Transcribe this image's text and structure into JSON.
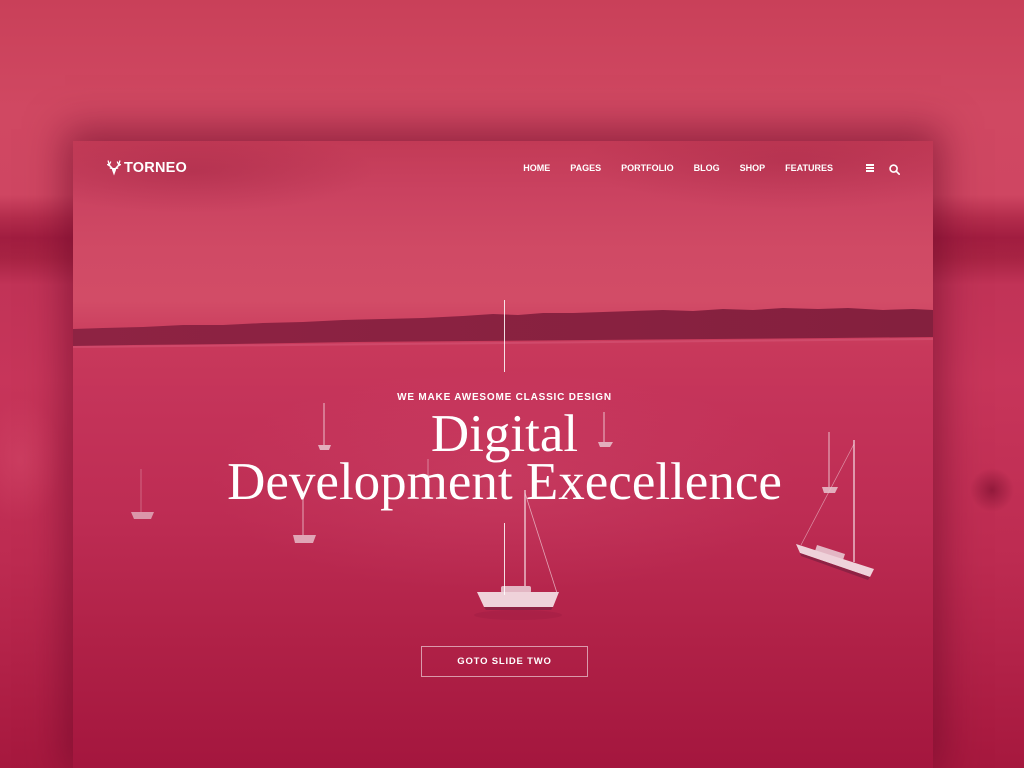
{
  "brand": {
    "name": "TORNEO",
    "logo_icon": "deer-head-icon"
  },
  "nav": {
    "items": [
      {
        "label": "HOME"
      },
      {
        "label": "PAGES"
      },
      {
        "label": "PORTFOLIO"
      },
      {
        "label": "BLOG"
      },
      {
        "label": "SHOP"
      },
      {
        "label": "FEATURES"
      }
    ]
  },
  "header_icons": {
    "menu": "hamburger-menu-icon",
    "search": "search-icon"
  },
  "hero": {
    "tagline": "WE MAKE AWESOME CLASSIC DESIGN",
    "title_line_1": "Digital",
    "title_line_2": "Development Execellence",
    "cta_label": "GOTO SLIDE TWO"
  },
  "colors": {
    "overlay_tint": "#c8365a",
    "text": "#ffffff",
    "land_silhouette": "#8e2342"
  }
}
